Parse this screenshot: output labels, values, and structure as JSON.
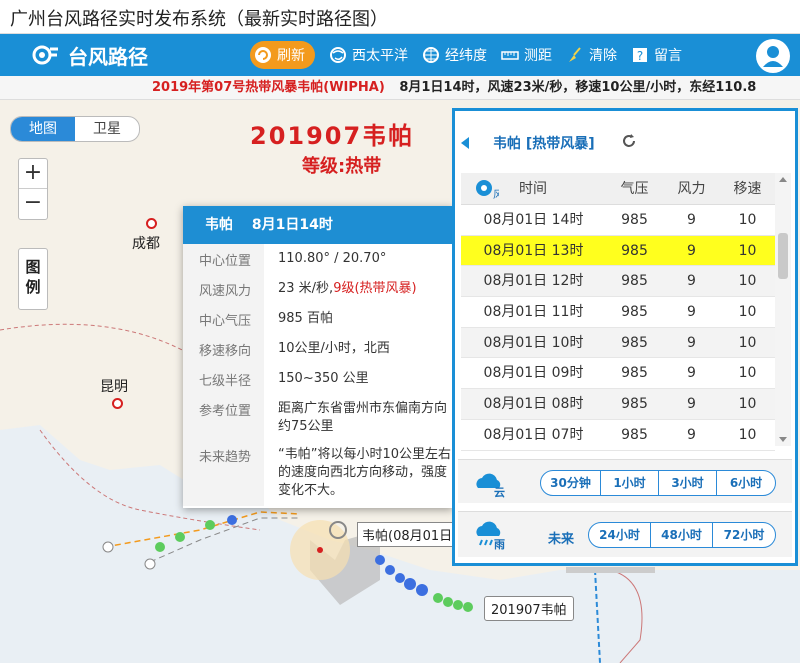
{
  "window": {
    "title": "广州台风路径实时发布系统（最新实时路径图）"
  },
  "navbar": {
    "logo_text": "台风路径",
    "items": [
      {
        "label": "刷新",
        "icon": "refresh-icon"
      },
      {
        "label": "西太平洋",
        "icon": "globe-icon"
      },
      {
        "label": "经纬度",
        "icon": "grid-globe-icon"
      },
      {
        "label": "测距",
        "icon": "ruler-icon"
      },
      {
        "label": "清除",
        "icon": "broom-icon"
      },
      {
        "label": "留言",
        "icon": "question-icon"
      }
    ],
    "user_icon": "user-icon"
  },
  "ticker": {
    "name": "2019年第07号热带风暴韦帕(WIPHA)",
    "info": "8月1日14时，风速23米/秒，移速10公里/小时，东经110.8"
  },
  "map": {
    "map_types": [
      "地图",
      "卫星"
    ],
    "zoom_in": "+",
    "zoom_out": "−",
    "legend": [
      "图",
      "例"
    ],
    "cities": [
      "成都",
      "昆明"
    ],
    "typhoon_title": "201907韦帕",
    "typhoon_level": "等级:热带",
    "track_label": "201907韦帕",
    "position_label": "韦帕(08月01日"
  },
  "popup": {
    "name": "韦帕",
    "time": "8月1日14时",
    "rows": [
      {
        "k": "中心位置",
        "v": "110.80° / 20.70°"
      },
      {
        "k": "风速风力",
        "v": "23 米/秒,",
        "red": "9级(热带风暴)"
      },
      {
        "k": "中心气压",
        "v": "985 百帕"
      },
      {
        "k": "移速移向",
        "v": "10公里/小时，北西"
      },
      {
        "k": "七级半径",
        "v": "150~350 公里"
      },
      {
        "k": "参考位置",
        "v": "距离广东省雷州市东偏南方向约75公里"
      },
      {
        "k": "未来趋势",
        "v": "“韦帕”将以每小时10公里左右的速度向西北方向移动，强度变化不大。"
      }
    ]
  },
  "panel": {
    "title": "韦帕 [热带风暴]",
    "columns": [
      "时间",
      "气压",
      "风力",
      "移速"
    ],
    "col_icon_label": "风",
    "rows": [
      {
        "time": "08月01日 14时",
        "pressure": "985",
        "force": "9",
        "speed": "10"
      },
      {
        "time": "08月01日 13时",
        "pressure": "985",
        "force": "9",
        "speed": "10",
        "selected": true
      },
      {
        "time": "08月01日 12时",
        "pressure": "985",
        "force": "9",
        "speed": "10"
      },
      {
        "time": "08月01日 11时",
        "pressure": "985",
        "force": "9",
        "speed": "10"
      },
      {
        "time": "08月01日 10时",
        "pressure": "985",
        "force": "9",
        "speed": "10"
      },
      {
        "time": "08月01日 09时",
        "pressure": "985",
        "force": "9",
        "speed": "10"
      },
      {
        "time": "08月01日 08时",
        "pressure": "985",
        "force": "9",
        "speed": "10"
      },
      {
        "time": "08月01日 07时",
        "pressure": "985",
        "force": "9",
        "speed": "10"
      }
    ],
    "cloud": {
      "icon_label": "云",
      "options": [
        "30分钟",
        "1小时",
        "3小时",
        "6小时"
      ]
    },
    "rain": {
      "icon_label": "雨",
      "future": "未来",
      "options": [
        "24小时",
        "48小时",
        "72小时"
      ]
    }
  },
  "colors": {
    "brand": "#1a8fd6",
    "alert": "#d62020",
    "highlight": "#ffff1e",
    "refresh": "#f39a1d"
  }
}
